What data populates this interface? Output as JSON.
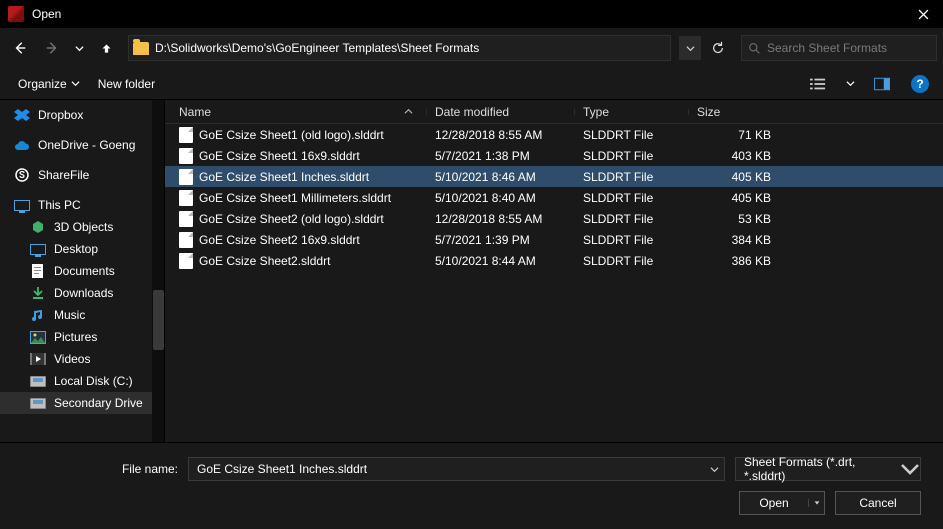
{
  "title": "Open",
  "address_path": "D:\\Solidworks\\Demo's\\GoEngineer Templates\\Sheet Formats",
  "search_placeholder": "Search Sheet Formats",
  "cmd": {
    "organize": "Organize",
    "new_folder": "New folder"
  },
  "columns": {
    "name": "Name",
    "date": "Date modified",
    "type": "Type",
    "size": "Size"
  },
  "tree": {
    "dropbox": "Dropbox",
    "onedrive": "OneDrive - Goeng",
    "sharefile": "ShareFile",
    "this_pc": "This PC",
    "objects3d": "3D Objects",
    "desktop": "Desktop",
    "documents": "Documents",
    "downloads": "Downloads",
    "music": "Music",
    "pictures": "Pictures",
    "videos": "Videos",
    "local_disk": "Local Disk (C:)",
    "secondary": "Secondary Drive"
  },
  "files": [
    {
      "name": "GoE Csize Sheet1 (old logo).slddrt",
      "date": "12/28/2018 8:55 AM",
      "type": "SLDDRT File",
      "size": "71 KB"
    },
    {
      "name": "GoE Csize Sheet1 16x9.slddrt",
      "date": "5/7/2021 1:38 PM",
      "type": "SLDDRT File",
      "size": "403 KB"
    },
    {
      "name": "GoE Csize Sheet1 Inches.slddrt",
      "date": "5/10/2021 8:46 AM",
      "type": "SLDDRT File",
      "size": "405 KB",
      "selected": true
    },
    {
      "name": "GoE Csize Sheet1 Millimeters.slddrt",
      "date": "5/10/2021 8:40 AM",
      "type": "SLDDRT File",
      "size": "405 KB"
    },
    {
      "name": "GoE Csize Sheet2 (old logo).slddrt",
      "date": "12/28/2018 8:55 AM",
      "type": "SLDDRT File",
      "size": "53 KB"
    },
    {
      "name": "GoE Csize Sheet2 16x9.slddrt",
      "date": "5/7/2021 1:39 PM",
      "type": "SLDDRT File",
      "size": "384 KB"
    },
    {
      "name": "GoE Csize Sheet2.slddrt",
      "date": "5/10/2021 8:44 AM",
      "type": "SLDDRT File",
      "size": "386 KB"
    }
  ],
  "filename_label": "File name:",
  "filename_value": "GoE Csize Sheet1 Inches.slddrt",
  "filter_value": "Sheet Formats (*.drt, *.slddrt)",
  "buttons": {
    "open": "Open",
    "cancel": "Cancel"
  },
  "help": "?"
}
